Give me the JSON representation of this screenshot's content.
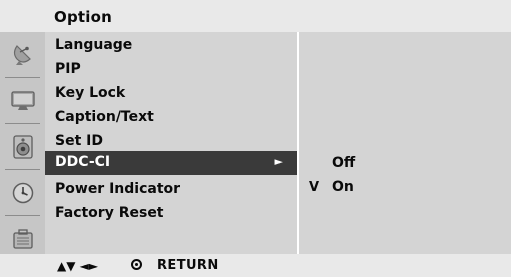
{
  "header": {
    "title": "Option"
  },
  "icons": [
    {
      "name": "satellite-dish-icon"
    },
    {
      "name": "picture-monitor-icon"
    },
    {
      "name": "speaker-audio-icon"
    },
    {
      "name": "clock-time-icon"
    },
    {
      "name": "option-menu-icon"
    }
  ],
  "menu": {
    "items": [
      {
        "label": "Language"
      },
      {
        "label": "PIP"
      },
      {
        "label": "Key Lock"
      },
      {
        "label": "Caption/Text"
      },
      {
        "label": "Set ID"
      },
      {
        "label": "DDC-CI",
        "arrow": "►",
        "selected": true
      },
      {
        "label": "Power Indicator"
      },
      {
        "label": "Factory Reset"
      }
    ]
  },
  "submenu": {
    "options": [
      {
        "label": "Off",
        "check": ""
      },
      {
        "label": "On",
        "check": "V"
      }
    ]
  },
  "footer": {
    "nav_glyphs": "▲▼ ◄►",
    "return_label": "RETURN"
  },
  "colors": {
    "title_bar": "#e9e9e9",
    "icon_column": "#c6c6c6",
    "menu_background": "#d4d4d4",
    "selected_background": "#3a3a3a",
    "selected_text": "#ffffff"
  }
}
